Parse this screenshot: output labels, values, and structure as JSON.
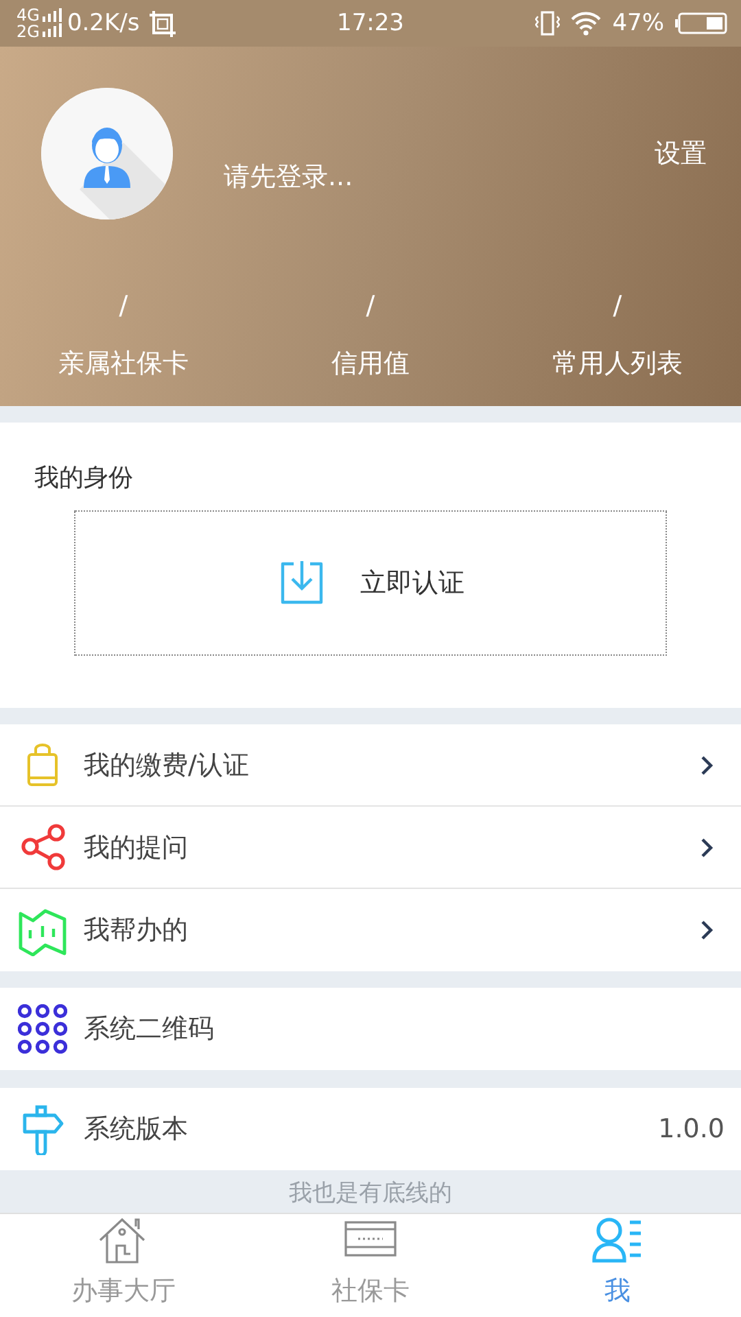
{
  "status_bar": {
    "network_top": "4G",
    "network_bottom": "2G",
    "speed": "0.2K/s",
    "time": "17:23",
    "battery": "47%"
  },
  "header": {
    "login_prompt": "请先登录...",
    "settings": "设置",
    "stats": [
      {
        "value": "/",
        "label": "亲属社保卡"
      },
      {
        "value": "/",
        "label": "信用值"
      },
      {
        "value": "/",
        "label": "常用人列表"
      }
    ]
  },
  "identity": {
    "title": "我的身份",
    "action": "立即认证"
  },
  "menu_groups": [
    {
      "items": [
        {
          "kind": "bag",
          "label": "我的缴费/认证",
          "chevron": true
        },
        {
          "kind": "share",
          "label": "我的提问",
          "chevron": true
        },
        {
          "kind": "map",
          "label": "我帮办的",
          "chevron": true
        }
      ]
    },
    {
      "items": [
        {
          "kind": "grid",
          "label": "系统二维码",
          "chevron": false
        }
      ]
    },
    {
      "items": [
        {
          "kind": "signpost",
          "label": "系统版本",
          "value": "1.0.0",
          "chevron": false
        }
      ]
    }
  ],
  "footer": "我也是有底线的",
  "tabs": [
    {
      "kind": "house",
      "label": "办事大厅",
      "selected": false
    },
    {
      "kind": "card",
      "label": "社保卡",
      "selected": false
    },
    {
      "kind": "person",
      "label": "我",
      "selected": true
    }
  ]
}
